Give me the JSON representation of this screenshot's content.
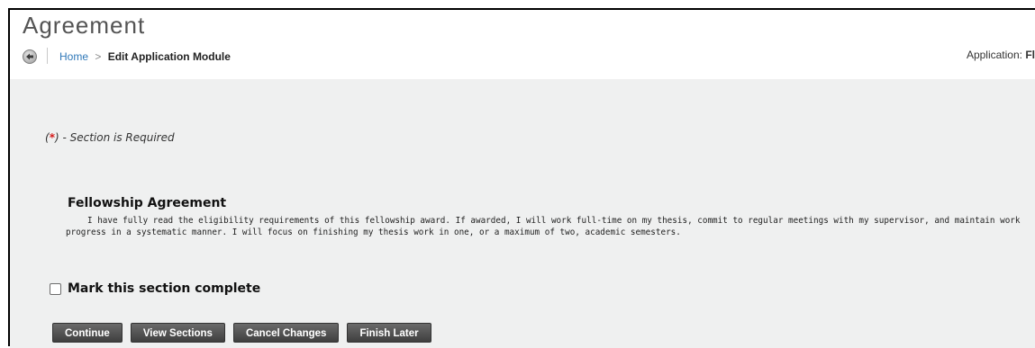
{
  "header": {
    "title": "Agreement",
    "application_label": "Application:",
    "application_value": "Fl"
  },
  "breadcrumb": {
    "home": "Home",
    "separator": ">",
    "current": "Edit Application Module"
  },
  "required_note": {
    "open": "(",
    "star": "*",
    "text": ") - Section is Required"
  },
  "section": {
    "title": "Fellowship Agreement",
    "body": "I have fully read the eligibility requirements of this fellowship award. If awarded, I will work full-time on my thesis, commit to regular meetings with my supervisor, and maintain work progress in a systematic manner. I will focus on finishing my thesis work in one, or a maximum of two, academic semesters."
  },
  "complete": {
    "label": "Mark this section complete",
    "checked": false
  },
  "buttons": {
    "continue": "Continue",
    "view_sections": "View Sections",
    "cancel_changes": "Cancel Changes",
    "finish_later": "Finish Later"
  },
  "icons": {
    "back": "back-arrow-icon"
  },
  "colors": {
    "link": "#2f78b8",
    "required_star": "#d51a1a",
    "content_bg": "#eff0f0",
    "button_bg": "#4f4f4f"
  }
}
